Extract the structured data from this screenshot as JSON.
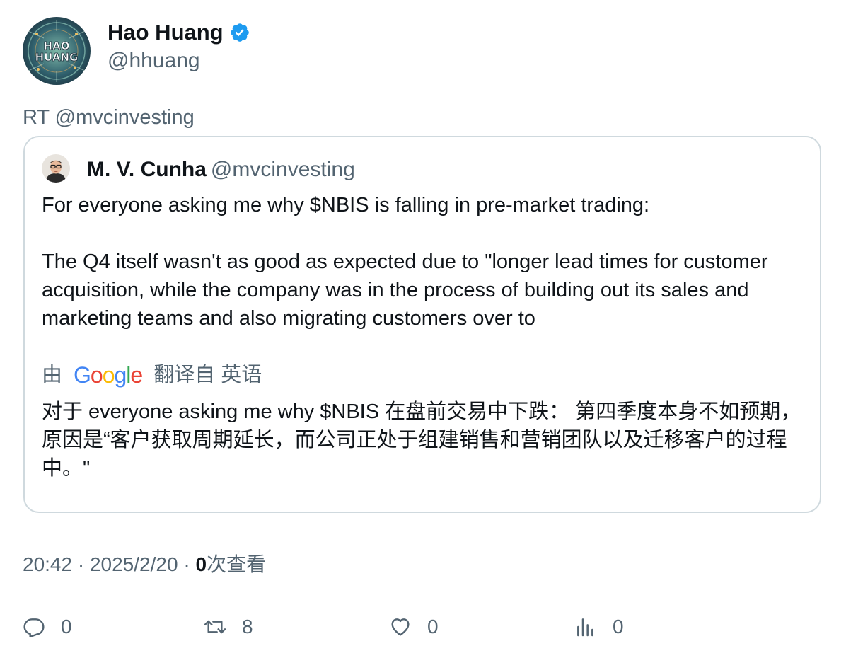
{
  "author": {
    "display_name": "Hao Huang",
    "handle": "@hhuang",
    "verified": true,
    "avatar_text_line1": "HAO",
    "avatar_text_line2": "HUANG"
  },
  "retweet_prefix": "RT @mvcinvesting",
  "quoted_tweet": {
    "author_name": "M. V. Cunha",
    "author_handle": "@mvcinvesting",
    "text": "For everyone asking me why $NBIS is falling in pre-market trading:\n\nThe Q4 itself wasn't as good as expected due to \"longer lead times for customer acquisition, while the company was in the process of building out its sales and marketing teams and also migrating customers over to",
    "translation": {
      "by_label": "由",
      "provider": "Google",
      "translated_from_label": "翻译自 英语",
      "text": "对于 everyone asking me why $NBIS 在盘前交易中下跌： 第四季度本身不如预期，原因是“客户获取周期延长，而公司正处于组建销售和营销团队以及迁移客户的过程中。\""
    }
  },
  "meta": {
    "time": "20:42",
    "date": "2025/2/20",
    "separator": "·",
    "views_count": "0",
    "views_label": "次查看"
  },
  "actions": {
    "reply_count": "0",
    "retweet_count": "8",
    "like_count": "0",
    "views_count": "0"
  },
  "colors": {
    "text_primary": "#0f1419",
    "text_secondary": "#536471",
    "verified_blue": "#1d9bf0",
    "border": "#cfd9de"
  }
}
